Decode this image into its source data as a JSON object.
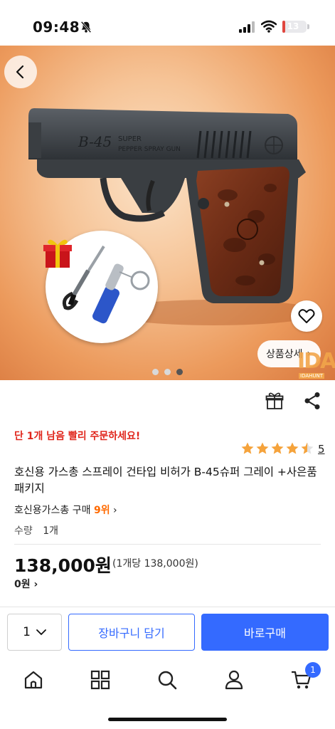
{
  "status_bar": {
    "time": "09:48",
    "battery": "13",
    "battery_level": 0.13,
    "icons": [
      "bell-slash-icon",
      "cellular-signal-icon",
      "wifi-icon",
      "battery-icon"
    ]
  },
  "hero": {
    "gun_marking_model": "B-45",
    "gun_marking_line1": "SUPER",
    "gun_marking_line2": "PEPPER SPRAY GUN",
    "detail_label": "상품상세",
    "watermark_text": "IDA",
    "watermark_sub": "IDAHUNT",
    "slide_count": 3,
    "active_slide": 3
  },
  "product": {
    "stock_alert": "단 1개 남음 빨리 주문하세요!",
    "rating": 4.5,
    "review_count": "5",
    "title": "호신용 가스총 스프레이 건타입 비허가 B-45슈퍼 그레이 +사은품패키지",
    "rank_category": "호신용가스총 구매",
    "rank_value": "9위",
    "qty_label": "수량",
    "qty_value": "1개",
    "price": "138,000원",
    "unit_price": "(1개당 138,000원)",
    "points": "0원"
  },
  "bottom_bar": {
    "qty_select": "1",
    "cart_button": "장바구니 담기",
    "buy_button": "바로구매",
    "cart_badge": "1"
  },
  "colors": {
    "accent": "#346aff",
    "alert": "#e0261c",
    "rank": "#ff6a00",
    "star": "#f5a33c"
  }
}
